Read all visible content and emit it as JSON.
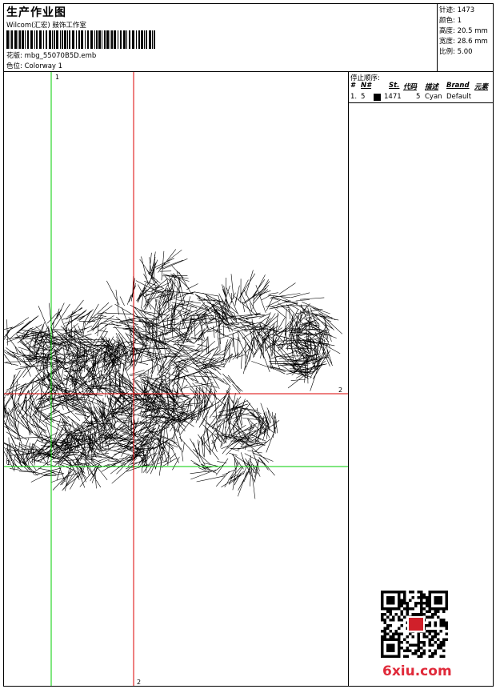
{
  "header": {
    "title": "生产作业图",
    "subtitle": "Wilcom(汇宏) 鼓饰工作室",
    "design_label": "花版:",
    "design_value": "mbg_55070B5D.emb",
    "colorway_label": "色位:",
    "colorway_value": "Colorway 1"
  },
  "stats": {
    "stitches_label": "针迹:",
    "stitches_value": "1473",
    "colors_label": "颜色:",
    "colors_value": "1",
    "height_label": "高度:",
    "height_value": "20.5 mm",
    "width_label": "宽度:",
    "width_value": "28.6 mm",
    "scale_label": "比例:",
    "scale_value": "5.00"
  },
  "stop_sequence": {
    "title": "停止顺序:",
    "columns": [
      "#",
      "N#",
      "St.",
      "代码",
      "描述",
      "Brand",
      "元素"
    ],
    "rows": [
      {
        "num": "1.",
        "needle": "5",
        "stitches": "1471",
        "code": "5",
        "desc": "Cyan",
        "brand": "Default",
        "swatch_color": "#000000"
      }
    ]
  },
  "axes": {
    "green_v_label": "1",
    "green_h_label": "1",
    "red_h_label": "2",
    "red_v_label": "2",
    "green_color": "#00cc00",
    "red_color": "#dd0000"
  },
  "watermark": {
    "brand_text": "6xiu.com",
    "brand_color": "#e02a3a",
    "qr_icon": "qr-code-icon"
  }
}
